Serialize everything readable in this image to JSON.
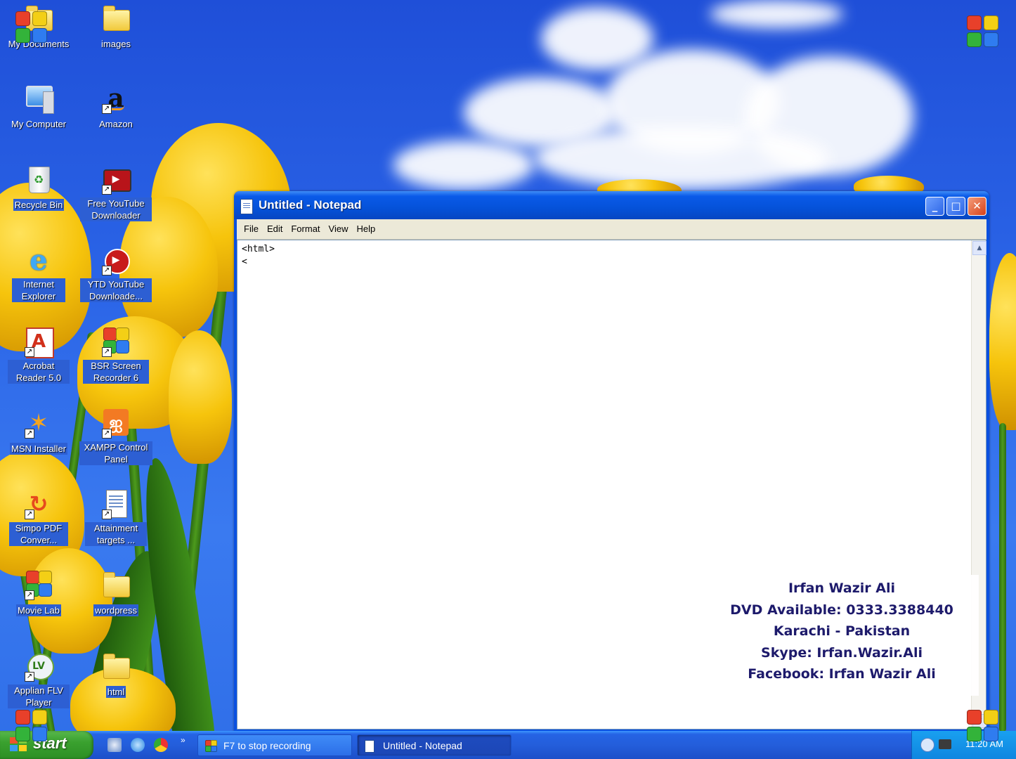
{
  "desktop": {
    "icons": [
      {
        "label": "My Documents",
        "icon": "my-documents-icon"
      },
      {
        "label": "images",
        "icon": "folder-icon"
      },
      {
        "label": "My Computer",
        "icon": "my-computer-icon"
      },
      {
        "label": "Amazon",
        "icon": "amazon-icon"
      },
      {
        "label": "Recycle Bin",
        "icon": "recycle-bin-icon"
      },
      {
        "label": "Free YouTube Downloader",
        "icon": "youtube-downloader-icon"
      },
      {
        "label": "Internet Explorer",
        "icon": "internet-explorer-icon"
      },
      {
        "label": "YTD YouTube Downloade...",
        "icon": "ytd-icon"
      },
      {
        "label": "Acrobat Reader 5.0",
        "icon": "acrobat-icon"
      },
      {
        "label": "BSR Screen Recorder 6",
        "icon": "bsr-recorder-icon"
      },
      {
        "label": "MSN Installer",
        "icon": "msn-icon"
      },
      {
        "label": "XAMPP Control Panel",
        "icon": "xampp-icon"
      },
      {
        "label": "Simpo PDF Conver...",
        "icon": "simpo-pdf-icon"
      },
      {
        "label": "Attainment targets ...",
        "icon": "document-icon"
      },
      {
        "label": "Movie Lab",
        "icon": "movie-lab-icon"
      },
      {
        "label": "wordpress",
        "icon": "folder-icon"
      },
      {
        "label": "Applian FLV Player",
        "icon": "flv-player-icon"
      },
      {
        "label": "html",
        "icon": "folder-icon"
      }
    ]
  },
  "notepad": {
    "title": "Untitled - Notepad",
    "menu": [
      "File",
      "Edit",
      "Format",
      "View",
      "Help"
    ],
    "content": "<html>\n<",
    "buttons": {
      "minimize": "_",
      "maximize": "□",
      "close": "✕"
    }
  },
  "promo": {
    "lines": [
      "Irfan Wazir Ali",
      "DVD Available: 0333.3388440",
      "Karachi - Pakistan",
      "Skype: Irfan.Wazir.Ali",
      "Facebook: Irfan Wazir Ali"
    ]
  },
  "taskbar": {
    "start_label": "start",
    "tasks": [
      {
        "label": "F7 to stop recording",
        "active": false
      },
      {
        "label": "Untitled - Notepad",
        "active": true
      }
    ],
    "quicklaunch_more": "»",
    "clock": "11:20 AM"
  },
  "colors": {
    "sky": "#2a63e6",
    "titlebar": "#0552d9",
    "start_green": "#3aa12f",
    "promo_text": "#1d1a6b"
  }
}
